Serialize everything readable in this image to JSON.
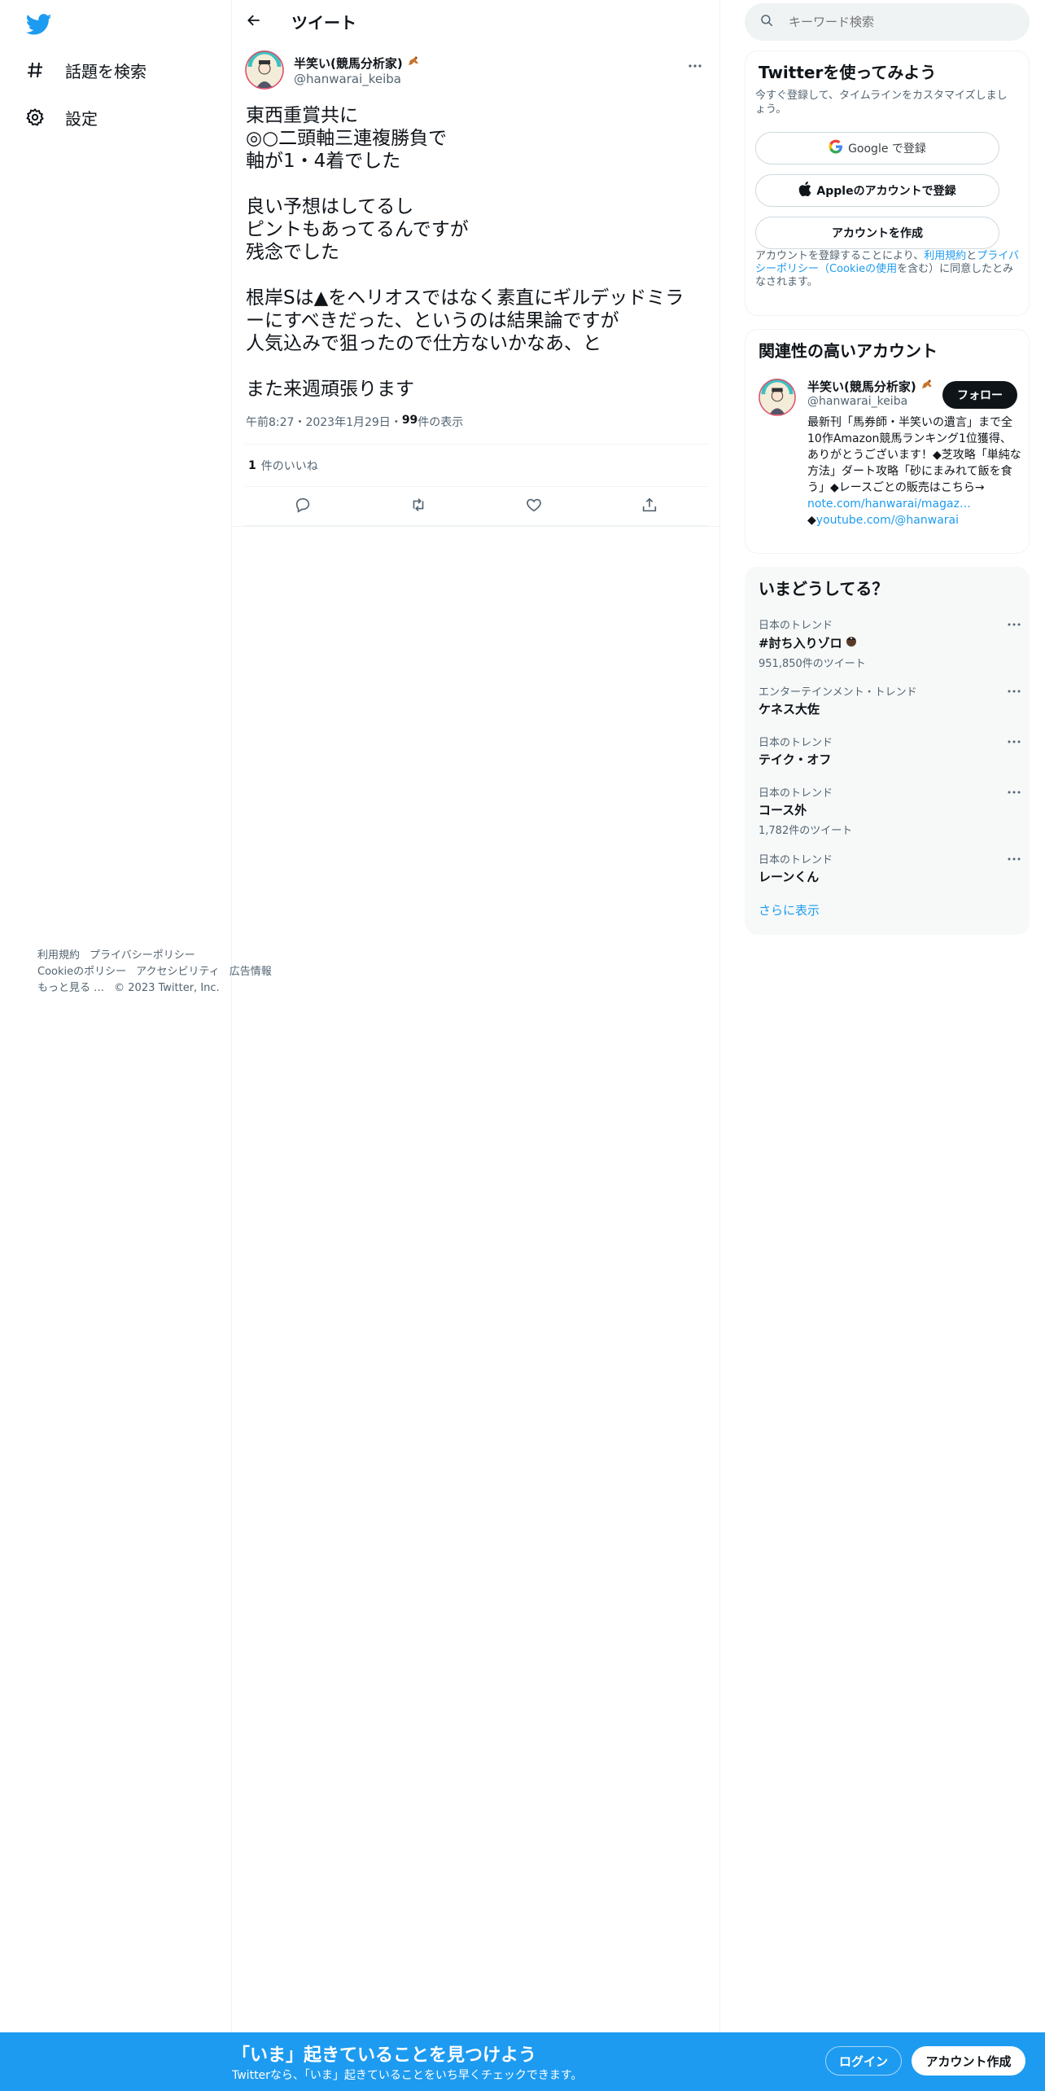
{
  "nav": {
    "explore_label": "話題を検索",
    "settings_label": "設定"
  },
  "header": {
    "title": "ツイート"
  },
  "tweet": {
    "author_name": "半笑い(競馬分析家)",
    "author_handle": "@hanwarai_keiba",
    "paragraphs": [
      [
        "東西重賞共に",
        "◎○二頭軸三連複勝負で",
        "軸が1・4着でした"
      ],
      [
        "良い予想はしてるし",
        "ピントもあってるんですが",
        "残念でした"
      ],
      [
        "根岸Sは▲をヘリオスではなく素直にギルデッドミラ",
        "ーにすべきだった、というのは結果論ですが",
        "人気込みで狙ったので仕方ないかなあ、と"
      ],
      [
        "また来週頑張ります"
      ]
    ],
    "time": "午前8:27",
    "date": "2023年1月29日",
    "separator": "・",
    "views_count": "99",
    "views_label": " 件の表示",
    "likes_count": "1",
    "likes_label": "件のいいね"
  },
  "search": {
    "placeholder": "キーワード検索"
  },
  "signup_card": {
    "title": "Twitterを使ってみよう",
    "subtitle": "今すぐ登録して、タイムラインをカスタマイズしましょう。",
    "google_label": "Google で登録",
    "apple_label": "Appleのアカウントで登録",
    "create_label": "アカウントを作成",
    "legal_prefix": "アカウントを登録することにより、",
    "legal_terms": "利用規約",
    "legal_and": "と",
    "legal_privacy": "プライバシーポリシー（Cookieの使用",
    "legal_suffix": "を含む）に同意したとみなされます。"
  },
  "related": {
    "title": "関連性の高いアカウント",
    "name": "半笑い(競馬分析家)",
    "handle": "@hanwarai_keiba",
    "follow_label": "フォロー",
    "bio_text": "最新刊「馬券師・半笑いの遺言」まで全10作Amazon競馬ランキング1位獲得、ありがとうございます！◆芝攻略「単純な方法」ダート攻略「砂にまみれて飯を食う」◆レースごとの販売はこちら→",
    "link1": "note.com/hanwarai/magaz…",
    "link2_prefix": "◆",
    "link2": "youtube.com/@hanwarai"
  },
  "trends": {
    "title": "いまどうしてる？",
    "items": [
      {
        "context": "日本のトレンド",
        "name": "#討ち入りゾロ",
        "count": "951,850件のツイート"
      },
      {
        "context": "エンターテインメント・トレンド",
        "name": "ケネス大佐",
        "count": ""
      },
      {
        "context": "日本のトレンド",
        "name": "テイク・オフ",
        "count": ""
      },
      {
        "context": "日本のトレンド",
        "name": "コース外",
        "count": "1,782件のツイート"
      },
      {
        "context": "日本のトレンド",
        "name": "レーンくん",
        "count": ""
      }
    ],
    "show_more": "さらに表示"
  },
  "footer": {
    "links": [
      "利用規約",
      "プライバシーポリシー",
      "Cookieのポリシー",
      "アクセシビリティ",
      "広告情報",
      "もっと見る …",
      "© 2023 Twitter, Inc."
    ]
  },
  "bottom_bar": {
    "title": "「いま」起きていることを見つけよう",
    "subtitle": "Twitterなら、「いま」起きていることをいち早くチェックできます。",
    "login_label": "ログイン",
    "signup_label": "アカウント作成"
  },
  "colors": {
    "brand": "#1d9bf0",
    "text": "#0f1419",
    "secondary": "#536471"
  },
  "icons": {
    "logo": "twitter-bird-icon",
    "explore": "hashtag-icon",
    "settings": "gear-icon",
    "back": "arrow-left-icon",
    "more": "more-dots-icon",
    "reply": "reply-icon",
    "retweet": "retweet-icon",
    "like": "heart-icon",
    "share": "share-icon",
    "search": "search-icon",
    "google": "google-icon",
    "apple": "apple-icon",
    "horse": "horse-emoji-icon"
  }
}
